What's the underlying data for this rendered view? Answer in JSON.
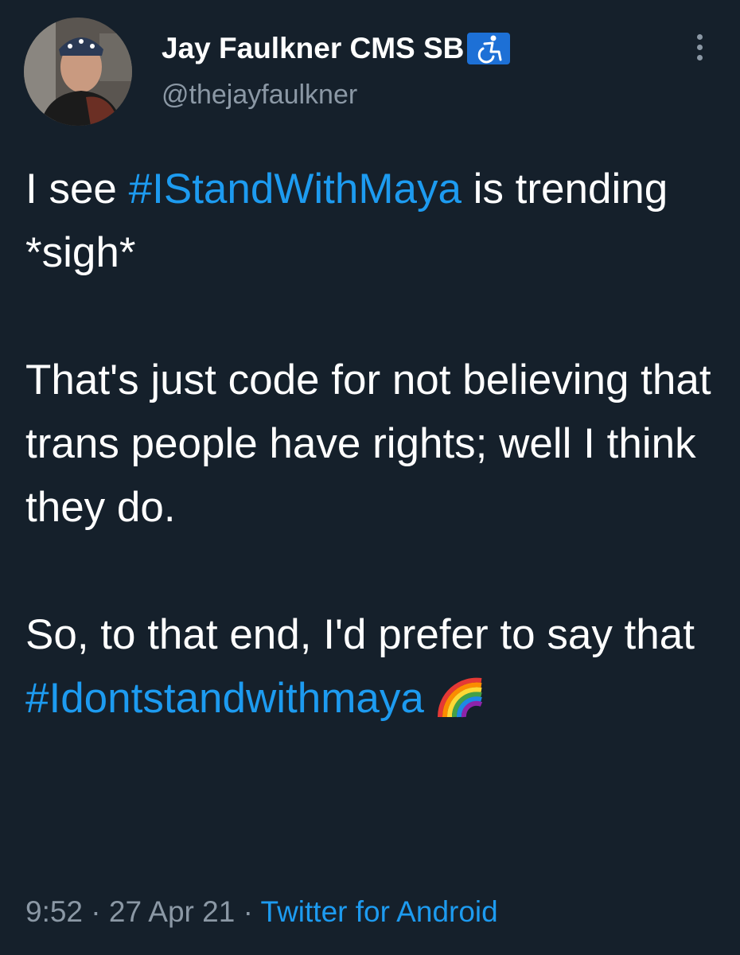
{
  "author": {
    "display_name": "Jay Faulkner CMS SB",
    "badge_icon": "wheelchair-icon",
    "handle": "@thejayfaulkner",
    "avatar_icon": "avatar"
  },
  "menu": {
    "more_icon": "more-vertical-icon"
  },
  "tweet": {
    "line1_prefix": "I see ",
    "hashtag1": "#IStandWithMaya",
    "line1_suffix": " is trending  *sigh*",
    "paragraph2": "That's just code for not believing that trans people have rights; well I think they do.",
    "paragraph3": "So, to that end, I'd prefer to say that",
    "hashtag2": "#Idontstandwithmaya",
    "emoji_icon": "rainbow-icon"
  },
  "meta": {
    "time": "9:52",
    "separator1": " · ",
    "date": "27 Apr 21",
    "separator2": " · ",
    "source": "Twitter for Android"
  },
  "colors": {
    "background": "#15202b",
    "link": "#1d9bf0",
    "secondary_text": "#8b98a5"
  }
}
